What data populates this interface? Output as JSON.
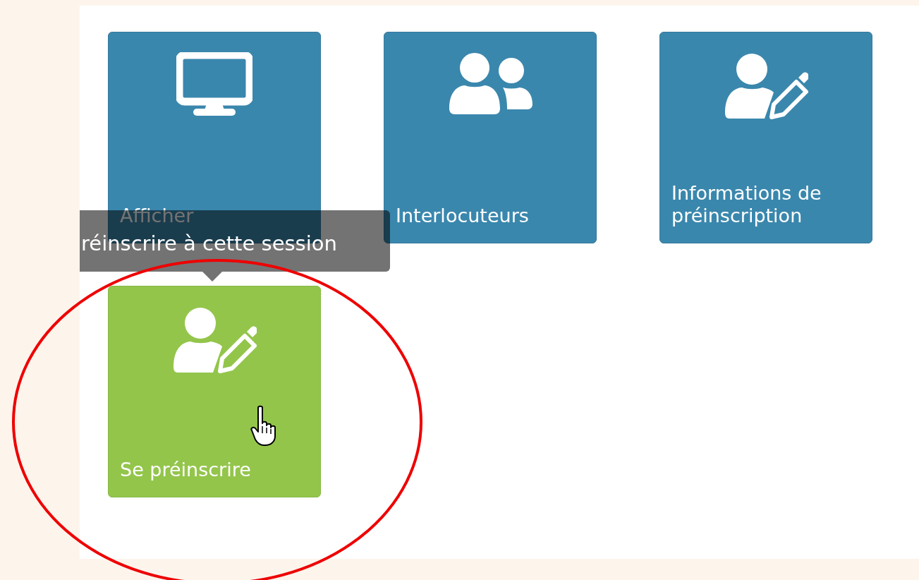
{
  "tiles": [
    {
      "label": "Afficher",
      "kind": "monitor",
      "highlighted": false
    },
    {
      "label": "Interlocuteurs",
      "kind": "people",
      "highlighted": false
    },
    {
      "label": "Informations de préinscription",
      "kind": "user-edit",
      "highlighted": false
    },
    {
      "label": "Se préinscrire",
      "kind": "user-edit",
      "highlighted": true
    }
  ],
  "tooltip": {
    "text": "réinscrire à cette session"
  },
  "annotation": {
    "kind": "ellipse"
  },
  "cursor": {
    "kind": "hand"
  }
}
